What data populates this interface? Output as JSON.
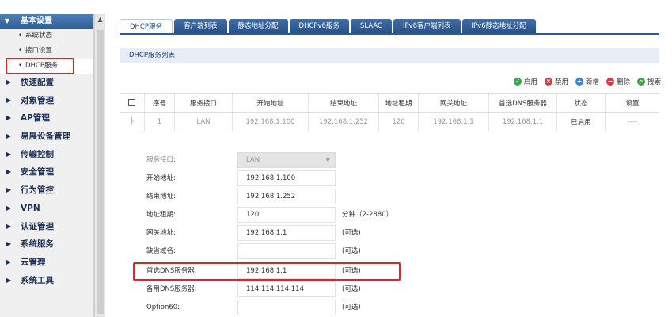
{
  "sidebar": {
    "group_label": "基本设置",
    "sub_items": [
      {
        "label": "系统状态"
      },
      {
        "label": "接口设置"
      },
      {
        "label": "DHCP服务"
      }
    ],
    "main_items": [
      {
        "label": "快速配置"
      },
      {
        "label": "对象管理"
      },
      {
        "label": "AP管理"
      },
      {
        "label": "易展设备管理"
      },
      {
        "label": "传输控制"
      },
      {
        "label": "安全管理"
      },
      {
        "label": "行为管控"
      },
      {
        "label": "VPN"
      },
      {
        "label": "认证管理"
      },
      {
        "label": "系统服务"
      },
      {
        "label": "云管理"
      },
      {
        "label": "系统工具"
      }
    ]
  },
  "tabs": [
    {
      "label": "DHCP服务"
    },
    {
      "label": "客户端列表"
    },
    {
      "label": "静态地址分配"
    },
    {
      "label": "DHCPv6服务"
    },
    {
      "label": "SLAAC"
    },
    {
      "label": "IPv6客户端列表"
    },
    {
      "label": "IPv6静态地址分配"
    }
  ],
  "section_title": "DHCP服务列表",
  "actions": [
    {
      "label": "启用",
      "icon": "check-icon",
      "color": "#3aa54a"
    },
    {
      "label": "禁用",
      "icon": "ban-icon",
      "color": "#d9363e"
    },
    {
      "label": "新增",
      "icon": "plus-icon",
      "color": "#2f86d6"
    },
    {
      "label": "删除",
      "icon": "minus-icon",
      "color": "#d9363e"
    },
    {
      "label": "搜索",
      "icon": "search-icon",
      "color": "#3aa54a"
    }
  ],
  "table": {
    "columns": [
      "序号",
      "服务接口",
      "开始地址",
      "结束地址",
      "地址租期",
      "网关地址",
      "首选DNS服务器",
      "状态",
      "设置"
    ],
    "rows": [
      [
        "1",
        "LAN",
        "192.168.1.100",
        "192.168.1.252",
        "120",
        "192.168.1.1",
        "192.168.1.1",
        "已启用",
        "----"
      ]
    ]
  },
  "form": {
    "interface": {
      "label": "服务接口:",
      "value": "LAN"
    },
    "start": {
      "label": "开始地址:",
      "value": "192.168.1.100"
    },
    "end": {
      "label": "结束地址:",
      "value": "192.168.1.252"
    },
    "lease": {
      "label": "地址租期:",
      "value": "120",
      "note": "分钟（2-2880）"
    },
    "gateway": {
      "label": "网关地址:",
      "value": "192.168.1.1",
      "note": "(可选)"
    },
    "domain": {
      "label": "缺省域名:",
      "value": "",
      "note": "(可选)"
    },
    "dns1": {
      "label": "首选DNS服务器:",
      "value": "192.168.1.1",
      "note": "(可选)"
    },
    "dns2": {
      "label": "备用DNS服务器:",
      "value": "114.114.114.114",
      "note": "(可选)"
    },
    "option60": {
      "label": "Option60:",
      "value": "",
      "note": "(可选)"
    }
  },
  "colors": {
    "sidebar_header": "#2f5f97",
    "tab": "#284f83",
    "highlight": "#e02424",
    "section_bg": "#e6edf6"
  }
}
